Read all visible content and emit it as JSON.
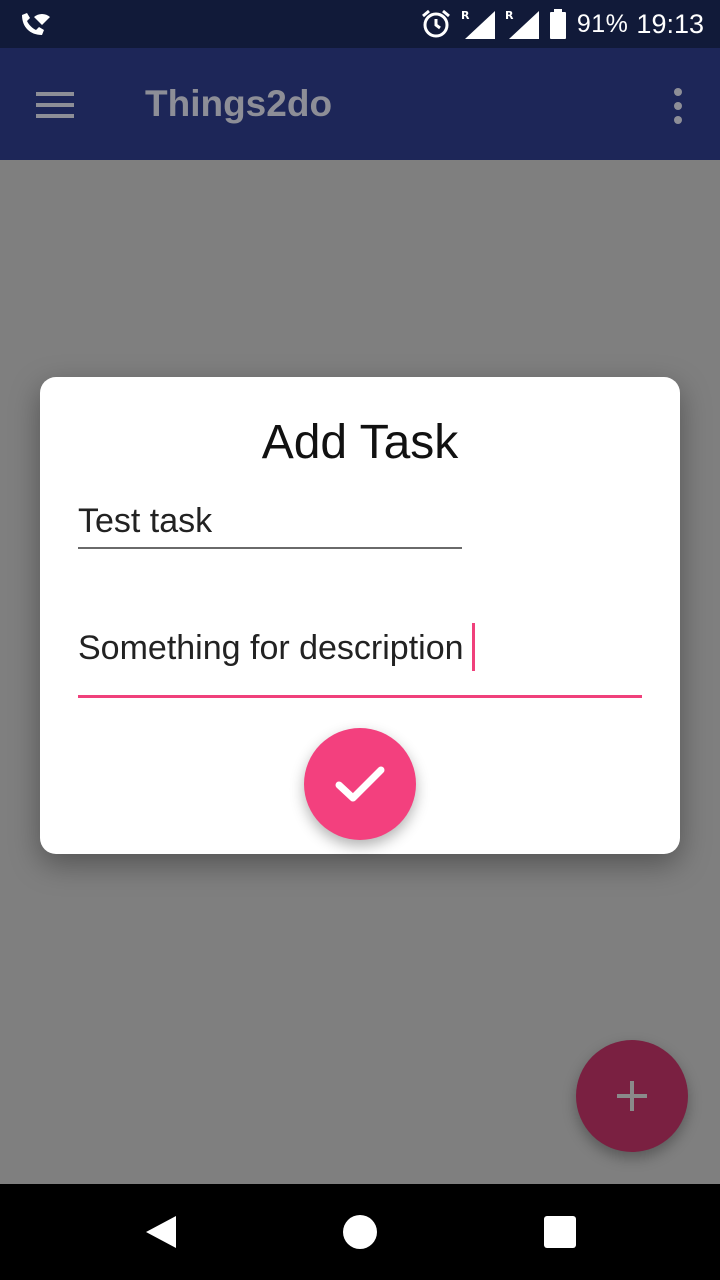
{
  "status_bar": {
    "battery_text": "91%",
    "time": "19:13",
    "icons": [
      "wifi-call-icon",
      "alarm-icon",
      "signal-r-icon",
      "signal-r-icon",
      "battery-icon"
    ]
  },
  "app_bar": {
    "title": "Things2do",
    "icons": [
      "menu-icon",
      "overflow-menu-icon"
    ]
  },
  "dialog": {
    "title": "Add Task",
    "name_value": "Test task",
    "description_value": "Something for description",
    "confirm_icon": "check-icon"
  },
  "fab": {
    "icon": "plus-icon"
  },
  "nav_bar": {
    "icons": [
      "back-icon",
      "home-icon",
      "recent-apps-icon"
    ]
  },
  "colors": {
    "accent": "#f3407e",
    "primary": "#1d2658",
    "status_bar": "#111a39",
    "scrim": "#7f7f7f"
  }
}
